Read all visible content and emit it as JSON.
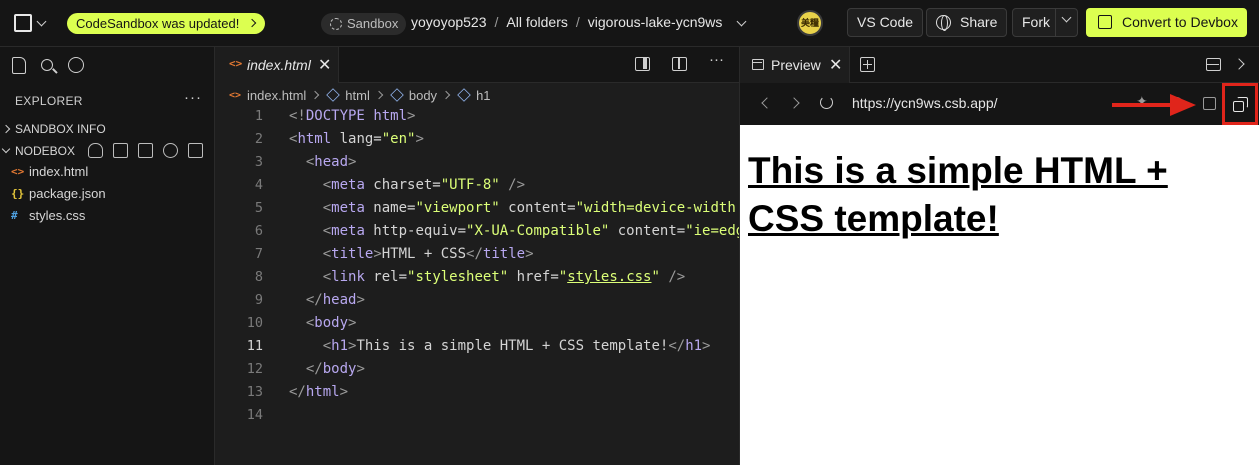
{
  "topbar": {
    "update_label": "CodeSandbox was updated!",
    "sandbox_label": "Sandbox",
    "crumbs": [
      "yoyoyop523",
      "All folders",
      "vigorous-lake-ycn9ws"
    ],
    "crumb_sep": "/",
    "avatar_text": "美糧",
    "vscode_label": "VS Code",
    "share_label": "Share",
    "fork_label": "Fork",
    "devbox_label": "Convert to Devbox",
    "accent_color": "#dcff50"
  },
  "sidebar": {
    "explorer_label": "EXPLORER",
    "sections": [
      {
        "label": "SANDBOX INFO",
        "expanded": false
      },
      {
        "label": "NODEBOX",
        "expanded": true
      }
    ],
    "files": [
      {
        "name": "index.html",
        "icon": "<>",
        "icon_color": "#e37933"
      },
      {
        "name": "package.json",
        "icon": "{}",
        "icon_color": "#e5c73b"
      },
      {
        "name": "styles.css",
        "icon": "#",
        "icon_color": "#4fa0e0"
      }
    ]
  },
  "editor": {
    "tab_label": "index.html",
    "tab_icon": "<>",
    "breadcrumb": [
      "index.html",
      "html",
      "body",
      "h1"
    ],
    "active_line": 11,
    "lines": [
      [
        [
          "pn",
          "<!"
        ],
        [
          "tg",
          "DOCTYPE"
        ],
        [
          "at",
          " "
        ],
        [
          "tg",
          "html"
        ],
        [
          "pn",
          ">"
        ]
      ],
      [
        [
          "pn",
          "<"
        ],
        [
          "tg",
          "html"
        ],
        [
          "at",
          " lang="
        ],
        [
          "st",
          "\"en\""
        ],
        [
          "pn",
          ">"
        ]
      ],
      [
        [
          "at",
          "  "
        ],
        [
          "pn",
          "<"
        ],
        [
          "tg",
          "head"
        ],
        [
          "pn",
          ">"
        ]
      ],
      [
        [
          "at",
          "    "
        ],
        [
          "pn",
          "<"
        ],
        [
          "tg",
          "meta"
        ],
        [
          "at",
          " charset="
        ],
        [
          "st",
          "\"UTF-8\""
        ],
        [
          "pn",
          " />"
        ]
      ],
      [
        [
          "at",
          "    "
        ],
        [
          "pn",
          "<"
        ],
        [
          "tg",
          "meta"
        ],
        [
          "at",
          " name="
        ],
        [
          "st",
          "\"viewport\""
        ],
        [
          "at",
          " content="
        ],
        [
          "st",
          "\"width=device-width"
        ]
      ],
      [
        [
          "at",
          "    "
        ],
        [
          "pn",
          "<"
        ],
        [
          "tg",
          "meta"
        ],
        [
          "at",
          " http-equiv="
        ],
        [
          "st",
          "\"X-UA-Compatible\""
        ],
        [
          "at",
          " content="
        ],
        [
          "st",
          "\"ie=edge"
        ]
      ],
      [
        [
          "at",
          "    "
        ],
        [
          "pn",
          "<"
        ],
        [
          "tg",
          "title"
        ],
        [
          "pn",
          ">"
        ],
        [
          "at",
          "HTML + CSS"
        ],
        [
          "pn",
          "</"
        ],
        [
          "tg",
          "title"
        ],
        [
          "pn",
          ">"
        ]
      ],
      [
        [
          "at",
          "    "
        ],
        [
          "pn",
          "<"
        ],
        [
          "tg",
          "link"
        ],
        [
          "at",
          " rel="
        ],
        [
          "st",
          "\"stylesheet\""
        ],
        [
          "at",
          " href="
        ],
        [
          "st",
          "\""
        ],
        [
          "stu",
          "styles.css"
        ],
        [
          "st",
          "\""
        ],
        [
          "pn",
          " />"
        ]
      ],
      [
        [
          "at",
          "  "
        ],
        [
          "pn",
          "</"
        ],
        [
          "tg",
          "head"
        ],
        [
          "pn",
          ">"
        ]
      ],
      [
        [
          "at",
          "  "
        ],
        [
          "pn",
          "<"
        ],
        [
          "tg",
          "body"
        ],
        [
          "pn",
          ">"
        ]
      ],
      [
        [
          "at",
          "    "
        ],
        [
          "pn",
          "<"
        ],
        [
          "tg",
          "h1"
        ],
        [
          "pn",
          ">"
        ],
        [
          "at",
          "This is a simple HTML + CSS template!"
        ],
        [
          "pn",
          "</"
        ],
        [
          "tg",
          "h1"
        ],
        [
          "pn",
          ">"
        ]
      ],
      [
        [
          "at",
          "  "
        ],
        [
          "pn",
          "</"
        ],
        [
          "tg",
          "body"
        ],
        [
          "pn",
          ">"
        ]
      ],
      [
        [
          "pn",
          "</"
        ],
        [
          "tg",
          "html"
        ],
        [
          "pn",
          ">"
        ]
      ],
      []
    ]
  },
  "preview": {
    "tab_label": "Preview",
    "url": "https://ycn9ws.csb.app/",
    "heading": "This is a simple HTML + CSS template!",
    "annotation_color": "#e0251b"
  }
}
